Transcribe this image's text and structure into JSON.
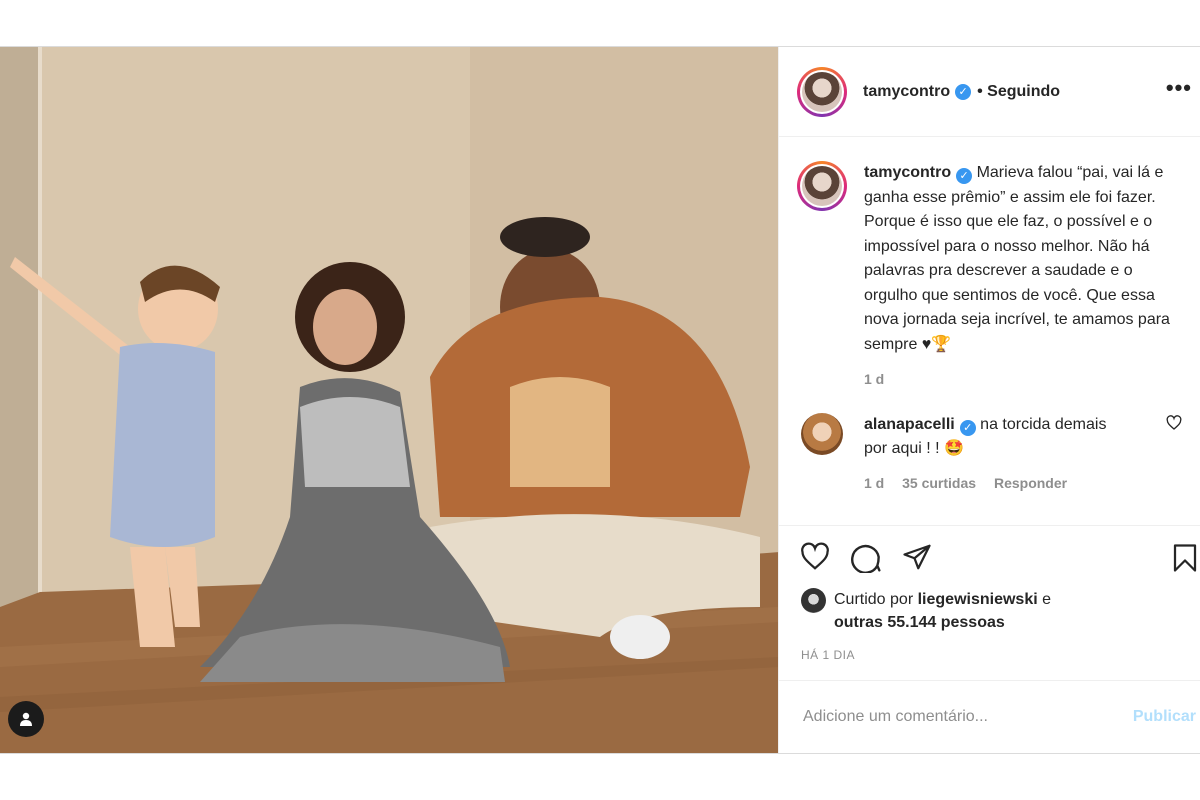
{
  "post": {
    "author": {
      "username": "tamycontro",
      "verified_icon": "verified-badge-icon",
      "follow_status": "• Seguindo"
    },
    "more_icon": "more-options-icon",
    "caption": {
      "username": "tamycontro",
      "text": "Marieva falou “pai, vai lá e ganha esse prêmio” e assim ele foi fazer. Porque é isso que ele faz, o possível e o impossível para o nosso melhor. Não há palavras pra descrever a saudade e o orgulho que sentimos de você. Que essa nova jornada seja incrível, te amamos para sempre ♥🏆",
      "age": "1 d"
    },
    "comments": [
      {
        "username": "alanapacelli",
        "text": "na torcida demais por aqui ! ! 🤩",
        "age": "1 d",
        "likes": "35 curtidas",
        "reply_label": "Responder"
      }
    ],
    "likes": {
      "prefix": "Curtido por",
      "user": "liegewisniewski",
      "suffix": "e",
      "others": "outras 55.144 pessoas"
    },
    "timestamp": "HÁ 1 DIA",
    "add_comment": {
      "placeholder": "Adicione um comentário...",
      "publish_label": "Publicar"
    },
    "colors": {
      "verified": "#3897f0",
      "publish_disabled": "#b2dffc",
      "muted": "#8e8e8e",
      "text": "#262626"
    }
  }
}
